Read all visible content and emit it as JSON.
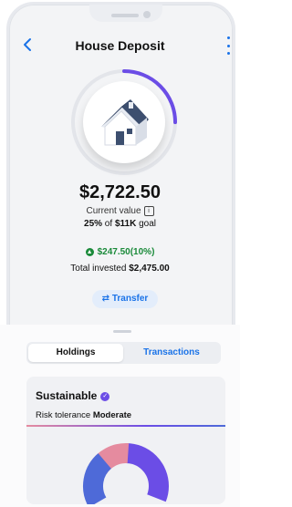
{
  "header": {
    "title": "House Deposit"
  },
  "progress": {
    "fraction": 0.25,
    "color": "#6b4de6"
  },
  "summary": {
    "value": "$2,722.50",
    "current_value_label": "Current value",
    "goal_pct": "25%",
    "goal_text": " of ",
    "goal_amount": "$11K",
    "goal_suffix": " goal",
    "gain": "$247.50(10%)",
    "invested_label": "Total invested ",
    "invested_value": "$2,475.00"
  },
  "actions": {
    "transfer": "Transfer"
  },
  "tabs": [
    {
      "label": "Holdings"
    },
    {
      "label": "Transactions"
    }
  ],
  "portfolio": {
    "title": "Sustainable",
    "risk_label": "Risk tolerance ",
    "risk_value": "Moderate"
  },
  "colors": {
    "accent": "#1a73e8",
    "positive": "#1a8a3a",
    "purple": "#6b4de6",
    "pink": "#e58b9f",
    "blue": "#4e6ad8"
  },
  "icons": {
    "back": "chevron-left-icon",
    "menu": "kebab-icon",
    "info": "info-icon",
    "gain": "arrow-up-icon",
    "transfer": "swap-icon",
    "verified": "verified-icon"
  }
}
